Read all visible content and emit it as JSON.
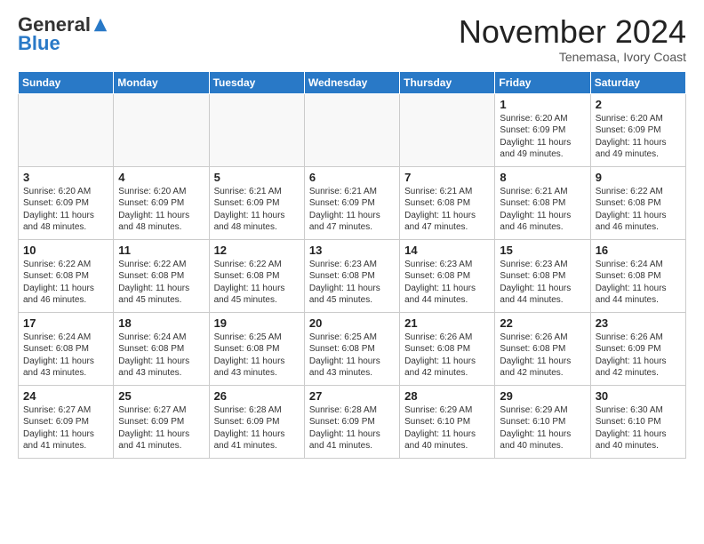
{
  "logo": {
    "general": "General",
    "blue": "Blue"
  },
  "header": {
    "month": "November 2024",
    "location": "Tenemasa, Ivory Coast"
  },
  "weekdays": [
    "Sunday",
    "Monday",
    "Tuesday",
    "Wednesday",
    "Thursday",
    "Friday",
    "Saturday"
  ],
  "weeks": [
    [
      {
        "day": "",
        "info": ""
      },
      {
        "day": "",
        "info": ""
      },
      {
        "day": "",
        "info": ""
      },
      {
        "day": "",
        "info": ""
      },
      {
        "day": "",
        "info": ""
      },
      {
        "day": "1",
        "info": "Sunrise: 6:20 AM\nSunset: 6:09 PM\nDaylight: 11 hours\nand 49 minutes."
      },
      {
        "day": "2",
        "info": "Sunrise: 6:20 AM\nSunset: 6:09 PM\nDaylight: 11 hours\nand 49 minutes."
      }
    ],
    [
      {
        "day": "3",
        "info": "Sunrise: 6:20 AM\nSunset: 6:09 PM\nDaylight: 11 hours\nand 48 minutes."
      },
      {
        "day": "4",
        "info": "Sunrise: 6:20 AM\nSunset: 6:09 PM\nDaylight: 11 hours\nand 48 minutes."
      },
      {
        "day": "5",
        "info": "Sunrise: 6:21 AM\nSunset: 6:09 PM\nDaylight: 11 hours\nand 48 minutes."
      },
      {
        "day": "6",
        "info": "Sunrise: 6:21 AM\nSunset: 6:09 PM\nDaylight: 11 hours\nand 47 minutes."
      },
      {
        "day": "7",
        "info": "Sunrise: 6:21 AM\nSunset: 6:08 PM\nDaylight: 11 hours\nand 47 minutes."
      },
      {
        "day": "8",
        "info": "Sunrise: 6:21 AM\nSunset: 6:08 PM\nDaylight: 11 hours\nand 46 minutes."
      },
      {
        "day": "9",
        "info": "Sunrise: 6:22 AM\nSunset: 6:08 PM\nDaylight: 11 hours\nand 46 minutes."
      }
    ],
    [
      {
        "day": "10",
        "info": "Sunrise: 6:22 AM\nSunset: 6:08 PM\nDaylight: 11 hours\nand 46 minutes."
      },
      {
        "day": "11",
        "info": "Sunrise: 6:22 AM\nSunset: 6:08 PM\nDaylight: 11 hours\nand 45 minutes."
      },
      {
        "day": "12",
        "info": "Sunrise: 6:22 AM\nSunset: 6:08 PM\nDaylight: 11 hours\nand 45 minutes."
      },
      {
        "day": "13",
        "info": "Sunrise: 6:23 AM\nSunset: 6:08 PM\nDaylight: 11 hours\nand 45 minutes."
      },
      {
        "day": "14",
        "info": "Sunrise: 6:23 AM\nSunset: 6:08 PM\nDaylight: 11 hours\nand 44 minutes."
      },
      {
        "day": "15",
        "info": "Sunrise: 6:23 AM\nSunset: 6:08 PM\nDaylight: 11 hours\nand 44 minutes."
      },
      {
        "day": "16",
        "info": "Sunrise: 6:24 AM\nSunset: 6:08 PM\nDaylight: 11 hours\nand 44 minutes."
      }
    ],
    [
      {
        "day": "17",
        "info": "Sunrise: 6:24 AM\nSunset: 6:08 PM\nDaylight: 11 hours\nand 43 minutes."
      },
      {
        "day": "18",
        "info": "Sunrise: 6:24 AM\nSunset: 6:08 PM\nDaylight: 11 hours\nand 43 minutes."
      },
      {
        "day": "19",
        "info": "Sunrise: 6:25 AM\nSunset: 6:08 PM\nDaylight: 11 hours\nand 43 minutes."
      },
      {
        "day": "20",
        "info": "Sunrise: 6:25 AM\nSunset: 6:08 PM\nDaylight: 11 hours\nand 43 minutes."
      },
      {
        "day": "21",
        "info": "Sunrise: 6:26 AM\nSunset: 6:08 PM\nDaylight: 11 hours\nand 42 minutes."
      },
      {
        "day": "22",
        "info": "Sunrise: 6:26 AM\nSunset: 6:08 PM\nDaylight: 11 hours\nand 42 minutes."
      },
      {
        "day": "23",
        "info": "Sunrise: 6:26 AM\nSunset: 6:09 PM\nDaylight: 11 hours\nand 42 minutes."
      }
    ],
    [
      {
        "day": "24",
        "info": "Sunrise: 6:27 AM\nSunset: 6:09 PM\nDaylight: 11 hours\nand 41 minutes."
      },
      {
        "day": "25",
        "info": "Sunrise: 6:27 AM\nSunset: 6:09 PM\nDaylight: 11 hours\nand 41 minutes."
      },
      {
        "day": "26",
        "info": "Sunrise: 6:28 AM\nSunset: 6:09 PM\nDaylight: 11 hours\nand 41 minutes."
      },
      {
        "day": "27",
        "info": "Sunrise: 6:28 AM\nSunset: 6:09 PM\nDaylight: 11 hours\nand 41 minutes."
      },
      {
        "day": "28",
        "info": "Sunrise: 6:29 AM\nSunset: 6:10 PM\nDaylight: 11 hours\nand 40 minutes."
      },
      {
        "day": "29",
        "info": "Sunrise: 6:29 AM\nSunset: 6:10 PM\nDaylight: 11 hours\nand 40 minutes."
      },
      {
        "day": "30",
        "info": "Sunrise: 6:30 AM\nSunset: 6:10 PM\nDaylight: 11 hours\nand 40 minutes."
      }
    ]
  ]
}
